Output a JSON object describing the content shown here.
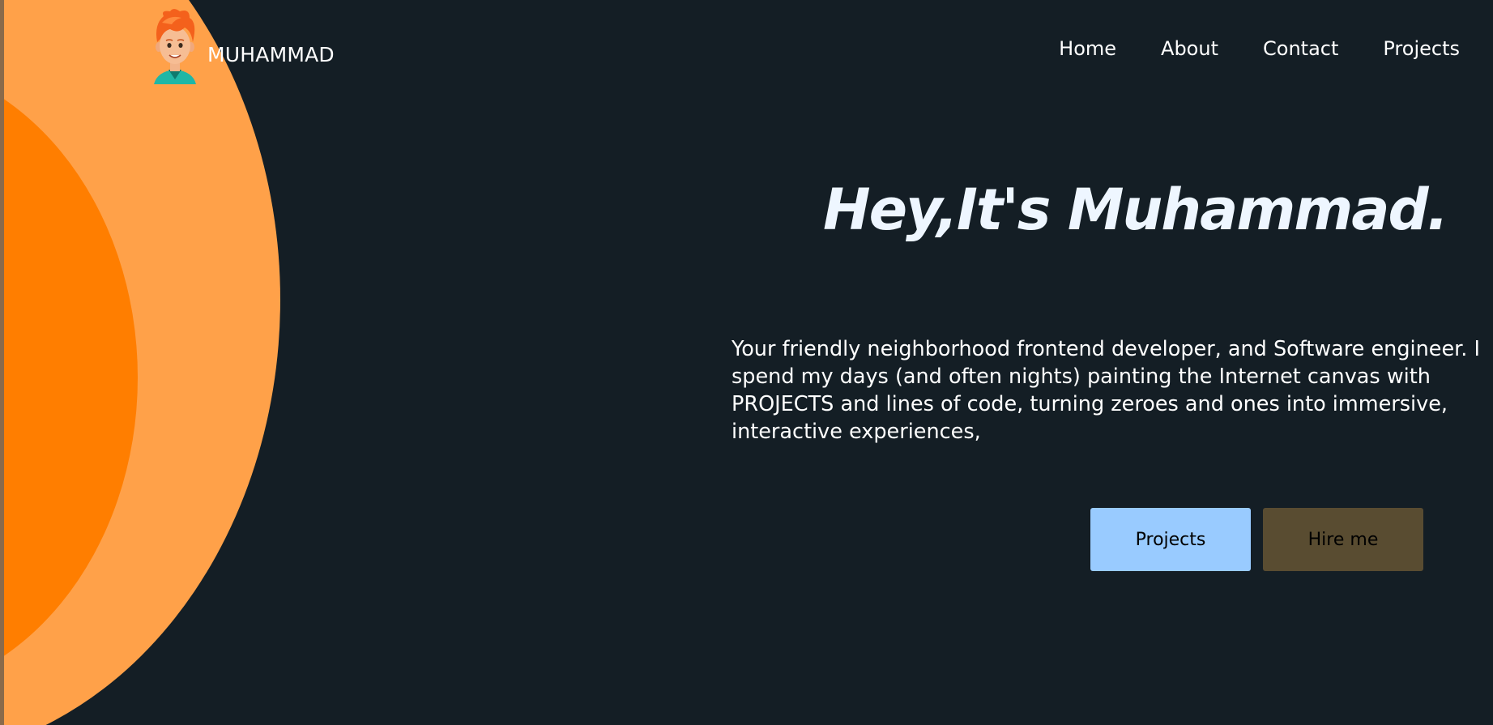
{
  "brand": {
    "name": "MUHAMMAD",
    "avatar_icon": "avatar-cartoon-orange-hair"
  },
  "nav": {
    "items": [
      {
        "label": "Home"
      },
      {
        "label": "About"
      },
      {
        "label": "Contact"
      },
      {
        "label": "Projects"
      }
    ]
  },
  "hero": {
    "title": "Hey,It's Muhammad.",
    "description": "Your friendly neighborhood frontend developer, and Software engineer. I spend my days (and often nights) painting the Internet canvas with PROJECTS and lines of code, turning zeroes and ones into immersive, interactive experiences,",
    "buttons": {
      "projects_label": "Projects",
      "hire_label": "Hire me"
    }
  },
  "colors": {
    "background": "#141e25",
    "circle_outer": "#ffa149",
    "circle_inner": "#ff7e00",
    "projects_button": "#99cbff",
    "hire_button": "#594c31",
    "title": "#eef6ff"
  }
}
